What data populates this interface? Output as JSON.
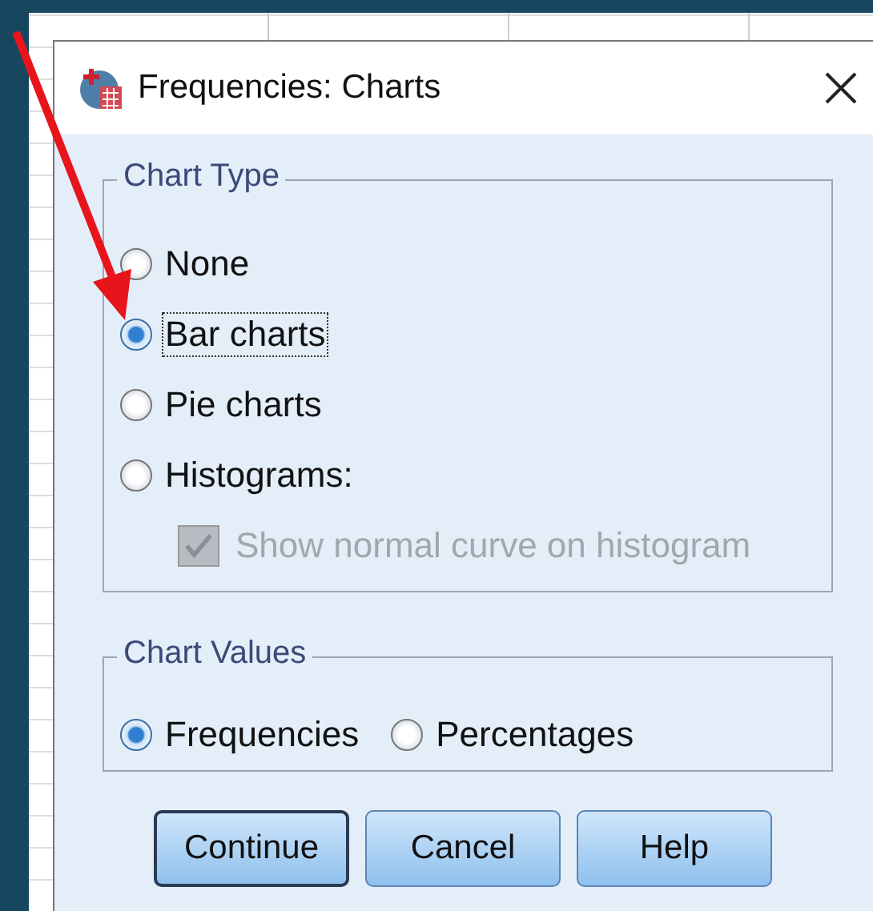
{
  "window": {
    "title": "Frequencies: Charts"
  },
  "chart_type": {
    "legend": "Chart Type",
    "options": [
      {
        "label": "None",
        "selected": false,
        "focused": false
      },
      {
        "label": "Bar charts",
        "selected": true,
        "focused": true
      },
      {
        "label": "Pie charts",
        "selected": false,
        "focused": false
      },
      {
        "label": "Histograms:",
        "selected": false,
        "focused": false
      }
    ],
    "normal_curve": {
      "label": "Show normal curve on histogram",
      "checked": true,
      "disabled": true
    }
  },
  "chart_values": {
    "legend": "Chart Values",
    "options": [
      {
        "label": "Frequencies",
        "selected": true,
        "focused": false
      },
      {
        "label": "Percentages",
        "selected": false,
        "focused": false
      }
    ]
  },
  "buttons": [
    {
      "label": "Continue",
      "default": true
    },
    {
      "label": "Cancel",
      "default": false
    },
    {
      "label": "Help",
      "default": false
    }
  ]
}
